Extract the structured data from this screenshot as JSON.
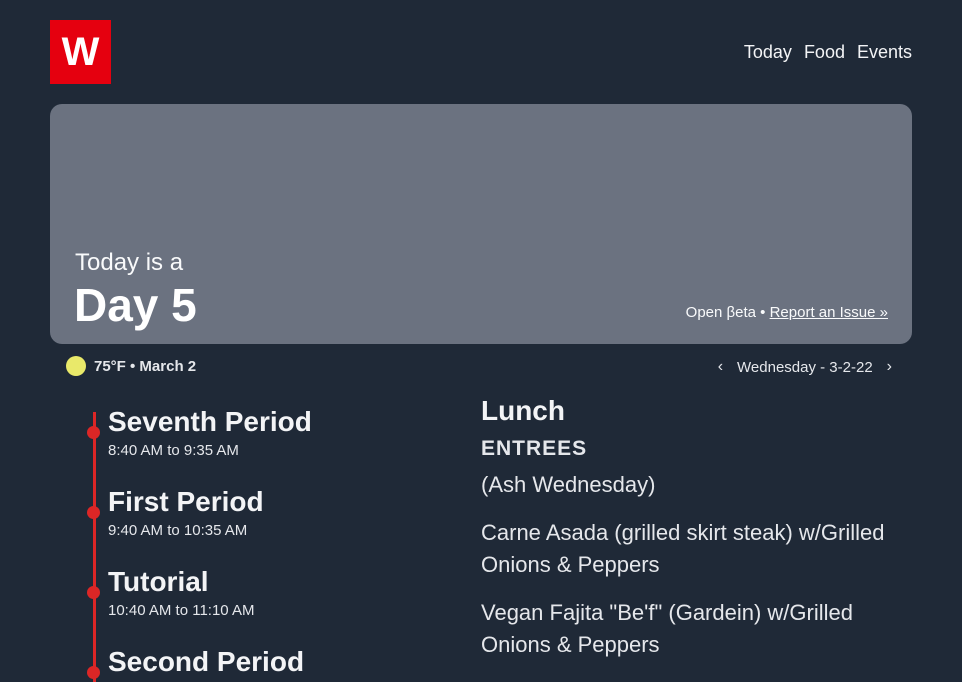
{
  "brand": {
    "logo_letter": "W",
    "logo_color": "#e5000f"
  },
  "nav": {
    "items": [
      "Today",
      "Food",
      "Events"
    ]
  },
  "hero": {
    "pretitle": "Today is a",
    "title": "Day 5",
    "beta_label": "Open βeta",
    "separator": " • ",
    "report_link": "Report an Issue »"
  },
  "weather": {
    "icon": "sun-icon",
    "text": "75°F • March 2"
  },
  "date_nav": {
    "prev": "‹",
    "label": "Wednesday - 3-2-22",
    "next": "›"
  },
  "schedule": {
    "accent": "#dc2626",
    "periods": [
      {
        "name": "Seventh Period",
        "time": "8:40 AM to 9:35 AM"
      },
      {
        "name": "First Period",
        "time": "9:40 AM to 10:35 AM"
      },
      {
        "name": "Tutorial",
        "time": "10:40 AM to 11:10 AM"
      },
      {
        "name": "Second Period",
        "time": ""
      }
    ]
  },
  "lunch": {
    "title": "Lunch",
    "section": "ENTREES",
    "items": [
      "(Ash Wednesday)",
      "Carne Asada (grilled skirt steak) w/Grilled Onions & Peppers",
      "Vegan Fajita \"Be'f\" (Gardein) w/Grilled Onions & Peppers"
    ]
  }
}
